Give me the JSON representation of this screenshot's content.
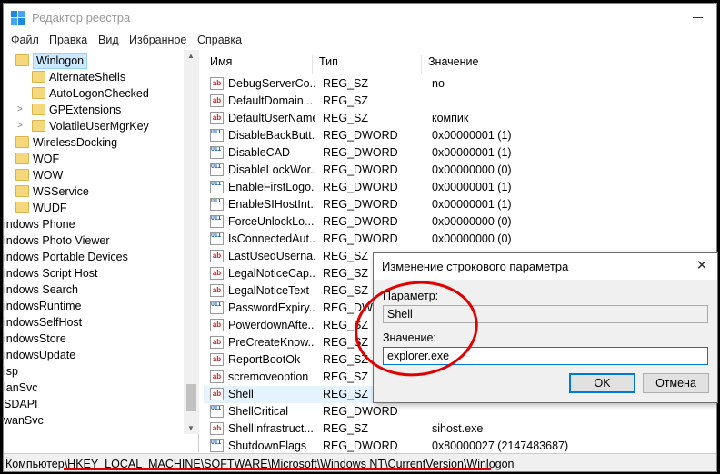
{
  "window": {
    "title": "Редактор реестра"
  },
  "menu": [
    "Файл",
    "Правка",
    "Вид",
    "Избранное",
    "Справка"
  ],
  "tree": [
    {
      "label": "Winlogon",
      "x": 13,
      "selected": true,
      "folder": true,
      "chev": ""
    },
    {
      "label": "AlternateShells",
      "x": 31,
      "folder": true,
      "chev": ""
    },
    {
      "label": "AutoLogonChecked",
      "x": 31,
      "folder": true,
      "chev": ""
    },
    {
      "label": "GPExtensions",
      "x": 31,
      "folder": true,
      "chev": ">"
    },
    {
      "label": "VolatileUserMgrKey",
      "x": 31,
      "folder": true,
      "chev": ">"
    },
    {
      "label": "WirelessDocking",
      "x": 13,
      "folder": true,
      "chev": ""
    },
    {
      "label": "WOF",
      "x": 13,
      "folder": true,
      "chev": ""
    },
    {
      "label": "WOW",
      "x": 13,
      "folder": true,
      "chev": ""
    },
    {
      "label": "WSService",
      "x": 13,
      "folder": true,
      "chev": ""
    },
    {
      "label": "WUDF",
      "x": 13,
      "folder": true,
      "chev": ""
    },
    {
      "label": "indows Phone",
      "x": 0,
      "folder": false,
      "chev": ""
    },
    {
      "label": "indows Photo Viewer",
      "x": 0,
      "folder": false,
      "chev": ""
    },
    {
      "label": "indows Portable Devices",
      "x": 0,
      "folder": false,
      "chev": ""
    },
    {
      "label": "indows Script Host",
      "x": 0,
      "folder": false,
      "chev": ""
    },
    {
      "label": "indows Search",
      "x": 0,
      "folder": false,
      "chev": ""
    },
    {
      "label": "indowsRuntime",
      "x": 0,
      "folder": false,
      "chev": ""
    },
    {
      "label": "indowsSelfHost",
      "x": 0,
      "folder": false,
      "chev": ""
    },
    {
      "label": "indowsStore",
      "x": 0,
      "folder": false,
      "chev": ""
    },
    {
      "label": "indowsUpdate",
      "x": 0,
      "folder": false,
      "chev": ""
    },
    {
      "label": "isp",
      "x": 0,
      "folder": false,
      "chev": ""
    },
    {
      "label": "lanSvc",
      "x": 0,
      "folder": false,
      "chev": ""
    },
    {
      "label": "SDAPI",
      "x": 0,
      "folder": false,
      "chev": ""
    },
    {
      "label": "wanSvc",
      "x": 0,
      "folder": false,
      "chev": ""
    }
  ],
  "columns": {
    "name": "Имя",
    "type": "Тип",
    "value": "Значение"
  },
  "rows": [
    {
      "icon": "ab",
      "name": "DebugServerCo...",
      "type": "REG_SZ",
      "value": "no"
    },
    {
      "icon": "ab",
      "name": "DefaultDomain...",
      "type": "REG_SZ",
      "value": ""
    },
    {
      "icon": "ab",
      "name": "DefaultUserName",
      "type": "REG_SZ",
      "value": "компик"
    },
    {
      "icon": "dw",
      "name": "DisableBackButt...",
      "type": "REG_DWORD",
      "value": "0x00000001 (1)"
    },
    {
      "icon": "dw",
      "name": "DisableCAD",
      "type": "REG_DWORD",
      "value": "0x00000001 (1)"
    },
    {
      "icon": "dw",
      "name": "DisableLockWor...",
      "type": "REG_DWORD",
      "value": "0x00000000 (0)"
    },
    {
      "icon": "dw",
      "name": "EnableFirstLogo...",
      "type": "REG_DWORD",
      "value": "0x00000001 (1)"
    },
    {
      "icon": "dw",
      "name": "EnableSIHostInt...",
      "type": "REG_DWORD",
      "value": "0x00000001 (1)"
    },
    {
      "icon": "dw",
      "name": "ForceUnlockLo...",
      "type": "REG_DWORD",
      "value": "0x00000000 (0)"
    },
    {
      "icon": "dw",
      "name": "IsConnectedAut...",
      "type": "REG_DWORD",
      "value": "0x00000000 (0)"
    },
    {
      "icon": "ab",
      "name": "LastUsedUserna...",
      "type": "REG_SZ",
      "value": ""
    },
    {
      "icon": "ab",
      "name": "LegalNoticeCap...",
      "type": "REG_SZ",
      "value": ""
    },
    {
      "icon": "ab",
      "name": "LegalNoticeText",
      "type": "REG_SZ",
      "value": ""
    },
    {
      "icon": "dw",
      "name": "PasswordExpiry...",
      "type": "REG_DWORD",
      "value": ""
    },
    {
      "icon": "ab",
      "name": "PowerdownAfte...",
      "type": "REG_SZ",
      "value": ""
    },
    {
      "icon": "ab",
      "name": "PreCreateKnow...",
      "type": "REG_SZ",
      "value": ""
    },
    {
      "icon": "ab",
      "name": "ReportBootOk",
      "type": "REG_SZ",
      "value": ""
    },
    {
      "icon": "ab",
      "name": "scremoveoption",
      "type": "REG_SZ",
      "value": ""
    },
    {
      "icon": "ab",
      "name": "Shell",
      "type": "REG_SZ",
      "value": "",
      "selected": true
    },
    {
      "icon": "dw",
      "name": "ShellCritical",
      "type": "REG_DWORD",
      "value": ""
    },
    {
      "icon": "ab",
      "name": "ShellInfrastruct...",
      "type": "REG_SZ",
      "value": "sihost.exe"
    },
    {
      "icon": "dw",
      "name": "ShutdownFlags",
      "type": "REG_DWORD",
      "value": "0x80000027 (2147483687)"
    }
  ],
  "status": {
    "path": "Компьютер\\HKEY_LOCAL_MACHINE\\SOFTWARE\\Microsoft\\Windows NT\\CurrentVersion\\Winlogon"
  },
  "dialog": {
    "title": "Изменение строкового параметра",
    "param_label": "Параметр:",
    "param_value": "Shell",
    "value_label": "Значение:",
    "value_value": "explorer.exe",
    "ok": "OK",
    "cancel": "Отмена"
  },
  "icon_labels": {
    "sz": "ab",
    "dw": "011 110"
  },
  "highlight_color": "#e00000"
}
